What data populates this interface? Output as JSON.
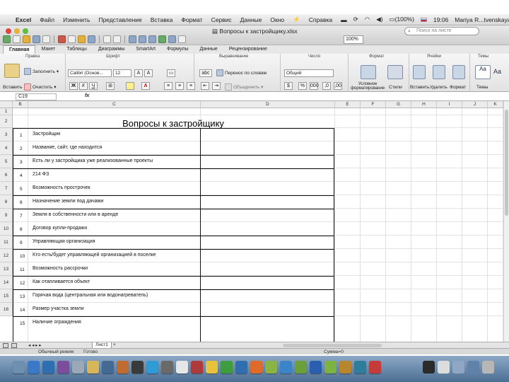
{
  "menubar": {
    "app_name": "Excel",
    "items": [
      "Файл",
      "Изменить",
      "Представление",
      "Вставка",
      "Формат",
      "Сервис",
      "Данные",
      "Окно",
      "Справка"
    ],
    "battery": "(100%)",
    "time": "19:06",
    "user": "Mariya R...tvenskaya"
  },
  "window": {
    "title": "Вопросы к застройщику.xlsx",
    "zoom": "100%",
    "search_placeholder": "Поиск на листе"
  },
  "ribbon": {
    "tabs": [
      "Главная",
      "Макет",
      "Таблицы",
      "Диаграммы",
      "SmartArt",
      "Формулы",
      "Данные",
      "Рецензирование"
    ],
    "active_tab": "Главная",
    "groups": {
      "edit": "Правка",
      "font": "Шрифт",
      "align": "Выравнивание",
      "number": "Число",
      "format": "Формат",
      "cells": "Ячейки",
      "themes": "Темы"
    },
    "paste_label": "Вставить",
    "fill_label": "Заполнить",
    "clear_label": "Очистить",
    "font_name": "Calibri (Основ...",
    "font_size": "12",
    "wrap_label": "Перенос по словам",
    "merge_label": "Объединить",
    "number_format": "Общий",
    "cond_format_label": "Условное форматирование",
    "styles_label": "Стили",
    "insert_label": "Вставить",
    "delete_label": "Удалить",
    "format_label": "Формат",
    "themes_label": "Темы",
    "font_sample": "Aa",
    "bold": "Ж",
    "italic": "К",
    "underline": "Ч",
    "abc": "abc"
  },
  "formula_bar": {
    "name_box": "C19",
    "fx": "fx",
    "content": ""
  },
  "grid": {
    "columns": [
      "A",
      "B",
      "C",
      "D",
      "E",
      "F",
      "G",
      "H",
      "I",
      "J",
      "K"
    ],
    "rows": [
      "1",
      "2",
      "3",
      "4",
      "5",
      "6",
      "7",
      "8",
      "9",
      "10",
      "11",
      "12",
      "13",
      "14",
      "15",
      "16"
    ],
    "sheet_title": "Вопросы к застройщику",
    "items": [
      {
        "num": "1",
        "text": "Застройщик"
      },
      {
        "num": "2",
        "text": "Название, сайт, где находится"
      },
      {
        "num": "3",
        "text": "Есть ли у застройщика уже реализованные проекты"
      },
      {
        "num": "4",
        "text": "214 ФЗ"
      },
      {
        "num": "5",
        "text": "Возможность прострочек"
      },
      {
        "num": "6",
        "text": "Назначение земли под дачами"
      },
      {
        "num": "7",
        "text": "Земля в собственности или в аренде"
      },
      {
        "num": "8",
        "text": "Договор купли-продажи"
      },
      {
        "num": "9",
        "text": "Управляющая организация"
      },
      {
        "num": "10",
        "text": "Кто есть/будет управляющей организацией в поселке"
      },
      {
        "num": "11",
        "text": "Возможность рассрочки"
      },
      {
        "num": "12",
        "text": "Как отапливается объект"
      },
      {
        "num": "13",
        "text": "Горячая вода (центральная или водонагреватель)"
      },
      {
        "num": "14",
        "text": "Размер участка земли"
      },
      {
        "num": "15",
        "text": "Наличие ограждения"
      }
    ]
  },
  "sheet_tabs": {
    "active": "Лист1"
  },
  "statusbar": {
    "mode": "Обычный режим",
    "state": "Готово",
    "sum": "Сумма=0"
  },
  "colors": {
    "dock_top": "#8ca8c6",
    "dock_bottom": "#4c6e93",
    "ribbon_bg": "#f6f6f6"
  }
}
